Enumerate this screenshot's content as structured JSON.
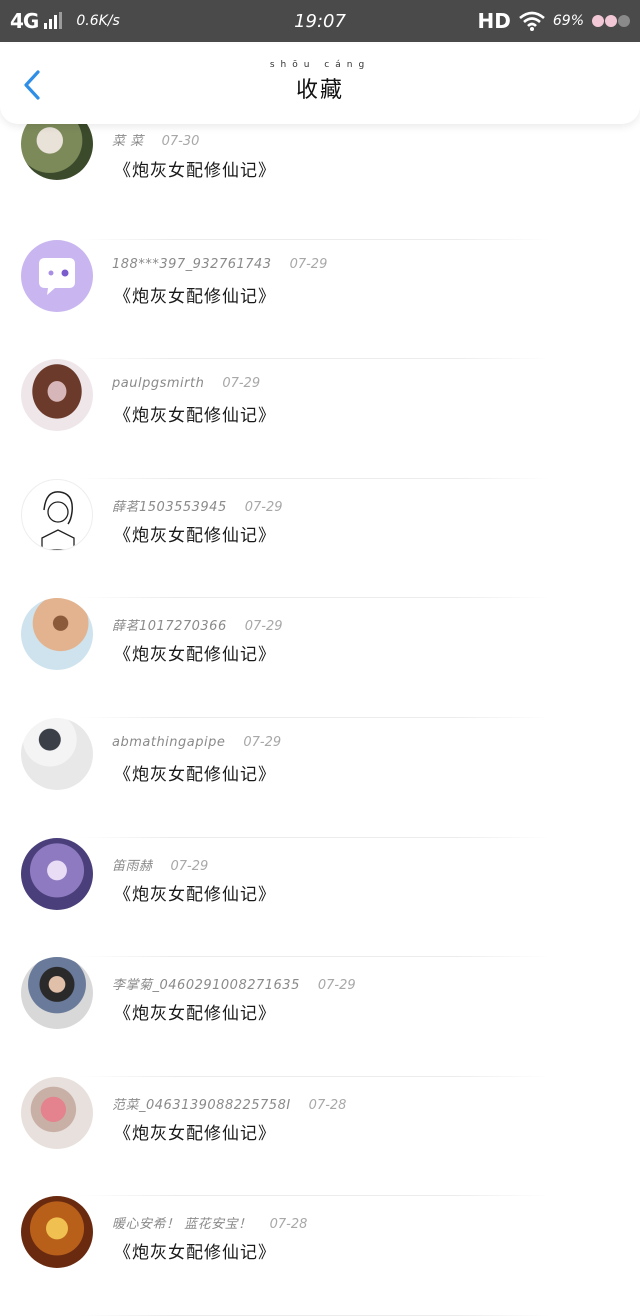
{
  "status_bar": {
    "network": "4G",
    "speed": "0.6K/s",
    "time": "19:07",
    "hd": "HD",
    "battery": "69%"
  },
  "header": {
    "title_pinyin": "shōu cáng",
    "title": "收藏"
  },
  "items": [
    {
      "user": "菜 菜",
      "date": "07-30",
      "title": "《炮灰女配修仙记》",
      "avatar_colors": [
        "#3b4a2a",
        "#d9d2c8",
        "#7c8a5a"
      ]
    },
    {
      "user": "188***397_932761743",
      "date": "07-29",
      "title": "《炮灰女配修仙记》",
      "avatar_colors": [
        "#c9b6f0",
        "#ffffff",
        "#a98ee6"
      ]
    },
    {
      "user": "paulpgsmirth",
      "date": "07-29",
      "title": "《炮灰女配修仙记》",
      "avatar_colors": [
        "#efe6ea",
        "#6b3a2a",
        "#d6b6b8"
      ]
    },
    {
      "user": "薛茗1503553945",
      "date": "07-29",
      "title": "《炮灰女配修仙记》",
      "avatar_colors": [
        "#ffffff",
        "#222222",
        "#cccccc"
      ]
    },
    {
      "user": "薛茗1017270366",
      "date": "07-29",
      "title": "《炮灰女配修仙记》",
      "avatar_colors": [
        "#cfe3ee",
        "#e2b38e",
        "#8a5a3a"
      ]
    },
    {
      "user": "abmathingapipe",
      "date": "07-29",
      "title": "《炮灰女配修仙记》",
      "avatar_colors": [
        "#f4f4f4",
        "#3a3f48",
        "#e8e8e8"
      ]
    },
    {
      "user": "笛雨赫",
      "date": "07-29",
      "title": "《炮灰女配修仙记》",
      "avatar_colors": [
        "#4a3f7a",
        "#c9b6e6",
        "#8e7ac0"
      ]
    },
    {
      "user": "李掌菊_0460291008271635",
      "date": "07-29",
      "title": "《炮灰女配修仙记》",
      "avatar_colors": [
        "#d8d8d8",
        "#2a2a2a",
        "#6a7a9a"
      ]
    },
    {
      "user": "范菜_0463139088225758I",
      "date": "07-28",
      "title": "《炮灰女配修仙记》",
      "avatar_colors": [
        "#e8e0dc",
        "#e4828e",
        "#c9b0a6"
      ]
    },
    {
      "user": "暖心安希！ 蓝花安宝！",
      "date": "07-28",
      "title": "《炮灰女配修仙记》",
      "avatar_colors": [
        "#b8601a",
        "#f0c050",
        "#6a2a10"
      ]
    }
  ]
}
